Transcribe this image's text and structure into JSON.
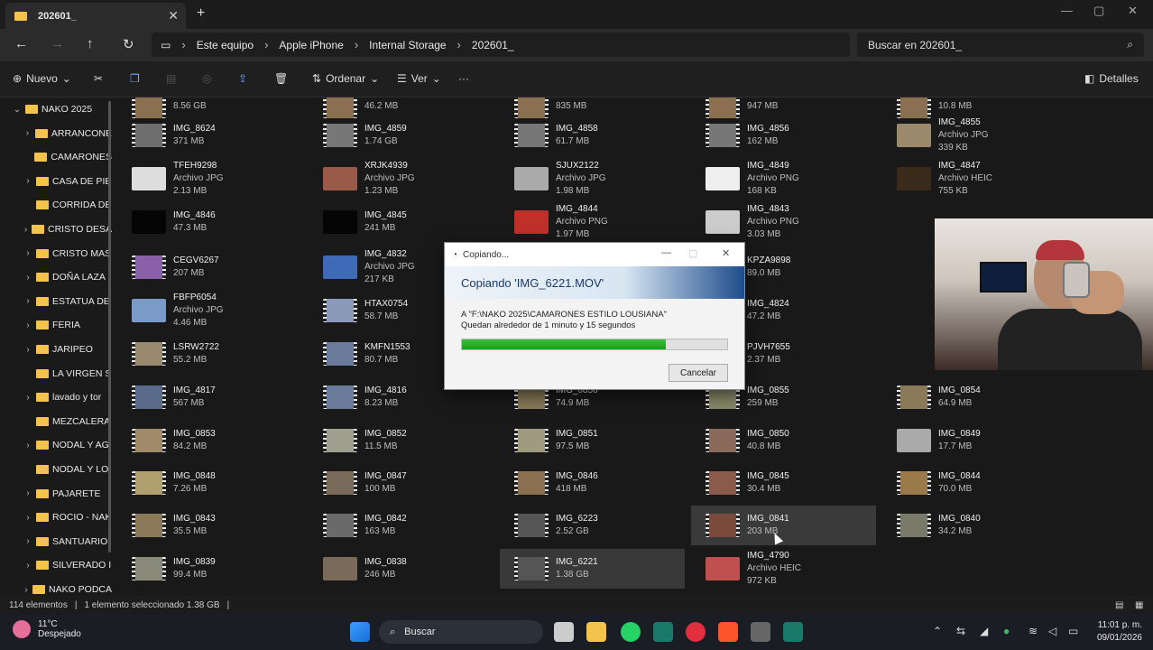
{
  "window": {
    "tab_title": "202601_",
    "tab_close": "✕",
    "new_tab": "+",
    "minimize": "—",
    "maximize": "▢",
    "close": "✕"
  },
  "nav": {
    "breadcrumb": [
      "Este equipo",
      "Apple iPhone",
      "Internal Storage",
      "202601_"
    ],
    "search_placeholder": "Buscar en 202601_"
  },
  "toolbar": {
    "new_label": "Nuevo",
    "sort_label": "Ordenar",
    "view_label": "Ver",
    "more_label": "···",
    "details_label": "Detalles"
  },
  "sidebar": {
    "items": [
      {
        "label": "NAKO 2025",
        "expanded": true
      },
      {
        "label": "ARRANCONE",
        "expandable": true
      },
      {
        "label": "CAMARONES",
        "expandable": false
      },
      {
        "label": "CASA DE PIE",
        "expandable": true
      },
      {
        "label": "CORRIDA DE",
        "expandable": false
      },
      {
        "label": "CRISTO DESA",
        "expandable": true
      },
      {
        "label": "CRISTO MAS",
        "expandable": true
      },
      {
        "label": "DOÑA LAZA",
        "expandable": true
      },
      {
        "label": "ESTATUA DE",
        "expandable": true
      },
      {
        "label": "FERIA",
        "expandable": true
      },
      {
        "label": "JARIPEO",
        "expandable": true
      },
      {
        "label": "LA VIRGEN S",
        "expandable": false
      },
      {
        "label": "lavado y tor",
        "expandable": true
      },
      {
        "label": "MEZCALERA",
        "expandable": false
      },
      {
        "label": "NODAL Y AG",
        "expandable": true
      },
      {
        "label": "NODAL Y LO",
        "expandable": false
      },
      {
        "label": "PAJARETE",
        "expandable": true
      },
      {
        "label": "ROCIO - NAK",
        "expandable": true
      },
      {
        "label": "SANTUARIO",
        "expandable": true
      },
      {
        "label": "SILVERADO I",
        "expandable": true
      },
      {
        "label": "NAKO PODCA",
        "expandable": true
      }
    ]
  },
  "files": [
    {
      "name": "",
      "size": "8.56 GB",
      "col": 0,
      "row": 0,
      "type": "vid",
      "color": "#8a7050"
    },
    {
      "name": "",
      "size": "46.2 MB",
      "col": 1,
      "row": 0,
      "type": "vid",
      "color": "#8a7050"
    },
    {
      "name": "",
      "size": "835 MB",
      "col": 2,
      "row": 0,
      "type": "vid",
      "color": "#8a7050"
    },
    {
      "name": "",
      "size": "947 MB",
      "col": 3,
      "row": 0,
      "type": "vid",
      "color": "#8a7050"
    },
    {
      "name": "",
      "size": "10.8 MB",
      "col": 4,
      "row": 0,
      "type": "vid",
      "color": "#8a7050"
    },
    {
      "name": "IMG_8624",
      "size": "371 MB",
      "col": 0,
      "row": 1,
      "type": "vid",
      "color": "#6e6e6e"
    },
    {
      "name": "IMG_4859",
      "size": "1.74 GB",
      "col": 1,
      "row": 1,
      "type": "vid",
      "color": "#777"
    },
    {
      "name": "IMG_4858",
      "size": "61.7 MB",
      "col": 2,
      "row": 1,
      "type": "vid",
      "color": "#777"
    },
    {
      "name": "IMG_4856",
      "size": "162 MB",
      "col": 3,
      "row": 1,
      "type": "vid",
      "color": "#777"
    },
    {
      "name": "IMG_4855",
      "kind": "Archivo JPG",
      "size": "339 KB",
      "col": 4,
      "row": 1,
      "type": "img",
      "color": "#9c8a6c"
    },
    {
      "name": "TFEH9298",
      "kind": "Archivo JPG",
      "size": "2.13 MB",
      "col": 0,
      "row": 2,
      "type": "img",
      "color": "#ddd"
    },
    {
      "name": "XRJK4939",
      "kind": "Archivo JPG",
      "size": "1.23 MB",
      "col": 1,
      "row": 2,
      "type": "img",
      "color": "#9a5a4a"
    },
    {
      "name": "SJUX2122",
      "kind": "Archivo JPG",
      "size": "1.98 MB",
      "col": 2,
      "row": 2,
      "type": "img",
      "color": "#aaa"
    },
    {
      "name": "IMG_4849",
      "kind": "Archivo PNG",
      "size": "168 KB",
      "col": 3,
      "row": 2,
      "type": "img",
      "color": "#eee"
    },
    {
      "name": "IMG_4847",
      "kind": "Archivo HEIC",
      "size": "755 KB",
      "col": 4,
      "row": 2,
      "type": "img",
      "color": "#3a2a1a"
    },
    {
      "name": "IMG_4846",
      "size": "47.3 MB",
      "col": 0,
      "row": 3,
      "type": "img",
      "color": "#050505"
    },
    {
      "name": "IMG_4845",
      "size": "241 MB",
      "col": 1,
      "row": 3,
      "type": "img",
      "color": "#050505"
    },
    {
      "name": "IMG_4844",
      "kind": "Archivo PNG",
      "size": "1.97 MB",
      "col": 2,
      "row": 3,
      "type": "img",
      "color": "#c0302a"
    },
    {
      "name": "IMG_4843",
      "kind": "Archivo PNG",
      "size": "3.03 MB",
      "col": 3,
      "row": 3,
      "type": "img",
      "color": "#ccc"
    },
    {
      "name": "CEGV6267",
      "size": "207 MB",
      "col": 0,
      "row": 4,
      "type": "vid",
      "color": "#8a60a8"
    },
    {
      "name": "IMG_4832",
      "kind": "Archivo JPG",
      "size": "217 KB",
      "col": 1,
      "row": 4,
      "type": "img",
      "color": "#3f6ab8"
    },
    {
      "name": "KPZA9898",
      "size": "89.0 MB",
      "col": 3,
      "row": 4,
      "type": "vid",
      "color": "#777"
    },
    {
      "name": "FBFP6054",
      "kind": "Archivo JPG",
      "size": "4.46 MB",
      "col": 0,
      "row": 5,
      "type": "img",
      "color": "#7a9ac8"
    },
    {
      "name": "HTAX0754",
      "size": "58.7 MB",
      "col": 1,
      "row": 5,
      "type": "vid",
      "color": "#8a9ab8"
    },
    {
      "name": "IMG_4824",
      "size": "47.2 MB",
      "col": 3,
      "row": 5,
      "type": "vid",
      "color": "#888"
    },
    {
      "name": "LSRW2722",
      "size": "55.2 MB",
      "col": 0,
      "row": 6,
      "type": "vid",
      "color": "#9a8a70"
    },
    {
      "name": "KMFN1553",
      "size": "80.7 MB",
      "col": 1,
      "row": 6,
      "type": "vid",
      "color": "#6a7a9a"
    },
    {
      "name": "PJVH7655",
      "size": "2.37 MB",
      "col": 3,
      "row": 6,
      "type": "vid",
      "color": "#888"
    },
    {
      "name": "IMG_4817",
      "size": "567 MB",
      "col": 0,
      "row": 7,
      "type": "vid",
      "color": "#5a6a8a"
    },
    {
      "name": "IMG_4816",
      "size": "8.23 MB",
      "col": 1,
      "row": 7,
      "type": "vid",
      "color": "#6a7a9a"
    },
    {
      "name": "IMG_0856",
      "size": "74.9 MB",
      "col": 2,
      "row": 7,
      "type": "vid",
      "color": "#8a7a5a"
    },
    {
      "name": "IMG_0855",
      "size": "259 MB",
      "col": 3,
      "row": 7,
      "type": "vid",
      "color": "#8a8a6a"
    },
    {
      "name": "IMG_0854",
      "size": "64.9 MB",
      "col": 4,
      "row": 7,
      "type": "vid",
      "color": "#8a7a5a"
    },
    {
      "name": "IMG_0853",
      "size": "84.2 MB",
      "col": 0,
      "row": 8,
      "type": "vid",
      "color": "#a08a6a"
    },
    {
      "name": "IMG_0852",
      "size": "11.5 MB",
      "col": 1,
      "row": 8,
      "type": "vid",
      "color": "#a0a090"
    },
    {
      "name": "IMG_0851",
      "size": "97.5 MB",
      "col": 2,
      "row": 8,
      "type": "vid",
      "color": "#a09a80"
    },
    {
      "name": "IMG_0850",
      "size": "40.8 MB",
      "col": 3,
      "row": 8,
      "type": "vid",
      "color": "#8a6a5a"
    },
    {
      "name": "IMG_0849",
      "size": "17.7 MB",
      "col": 4,
      "row": 8,
      "type": "img",
      "color": "#aaa"
    },
    {
      "name": "IMG_0848",
      "size": "7.26 MB",
      "col": 0,
      "row": 9,
      "type": "vid",
      "color": "#b0a070"
    },
    {
      "name": "IMG_0847",
      "size": "100 MB",
      "col": 1,
      "row": 9,
      "type": "vid",
      "color": "#7a6a5a"
    },
    {
      "name": "IMG_0846",
      "size": "418 MB",
      "col": 2,
      "row": 9,
      "type": "vid",
      "color": "#8a7050"
    },
    {
      "name": "IMG_0845",
      "size": "30.4 MB",
      "col": 3,
      "row": 9,
      "type": "vid",
      "color": "#8a5a4a"
    },
    {
      "name": "IMG_0844",
      "size": "70.0 MB",
      "col": 4,
      "row": 9,
      "type": "vid",
      "color": "#9a7a4a"
    },
    {
      "name": "IMG_0843",
      "size": "35.5 MB",
      "col": 0,
      "row": 10,
      "type": "vid",
      "color": "#8a7a5a"
    },
    {
      "name": "IMG_0842",
      "size": "163 MB",
      "col": 1,
      "row": 10,
      "type": "vid",
      "color": "#6a6a6a"
    },
    {
      "name": "IMG_6223",
      "size": "2.52 GB",
      "col": 2,
      "row": 10,
      "type": "vid",
      "color": "#555"
    },
    {
      "name": "IMG_0841",
      "size": "203 MB",
      "col": 3,
      "row": 10,
      "type": "vid",
      "color": "#7a4a3a",
      "state": "hover"
    },
    {
      "name": "IMG_0840",
      "size": "34.2 MB",
      "col": 4,
      "row": 10,
      "type": "vid",
      "color": "#7a7a6a"
    },
    {
      "name": "IMG_0839",
      "size": "99.4 MB",
      "col": 0,
      "row": 11,
      "type": "vid",
      "color": "#8a8a7a"
    },
    {
      "name": "IMG_0838",
      "size": "246 MB",
      "col": 1,
      "row": 11,
      "type": "img",
      "color": "#7a6a5a"
    },
    {
      "name": "IMG_6221",
      "size": "1.38 GB",
      "col": 2,
      "row": 11,
      "type": "vid",
      "color": "#555",
      "state": "selected"
    },
    {
      "name": "IMG_4790",
      "kind": "Archivo HEIC",
      "size": "972 KB",
      "col": 3,
      "row": 11,
      "type": "img",
      "color": "#c05050"
    }
  ],
  "dialog": {
    "title": "Copiando...",
    "heading": "Copiando 'IMG_6221.MOV'",
    "destination": "A \"F:\\NAKO 2025\\CAMARONES ESTILO LOUSIANA\"",
    "remaining": "Quedan alrededor de 1 minuto y 15 segundos",
    "progress": 0.77,
    "cancel_label": "Cancelar"
  },
  "status": {
    "count": "114 elementos",
    "selection": "1 elemento seleccionado  1.38 GB"
  },
  "taskbar": {
    "temperature": "11°C",
    "weather": "Despejado",
    "search_label": "Buscar",
    "time": "11:01 p. m.",
    "date": "09/01/2026"
  }
}
